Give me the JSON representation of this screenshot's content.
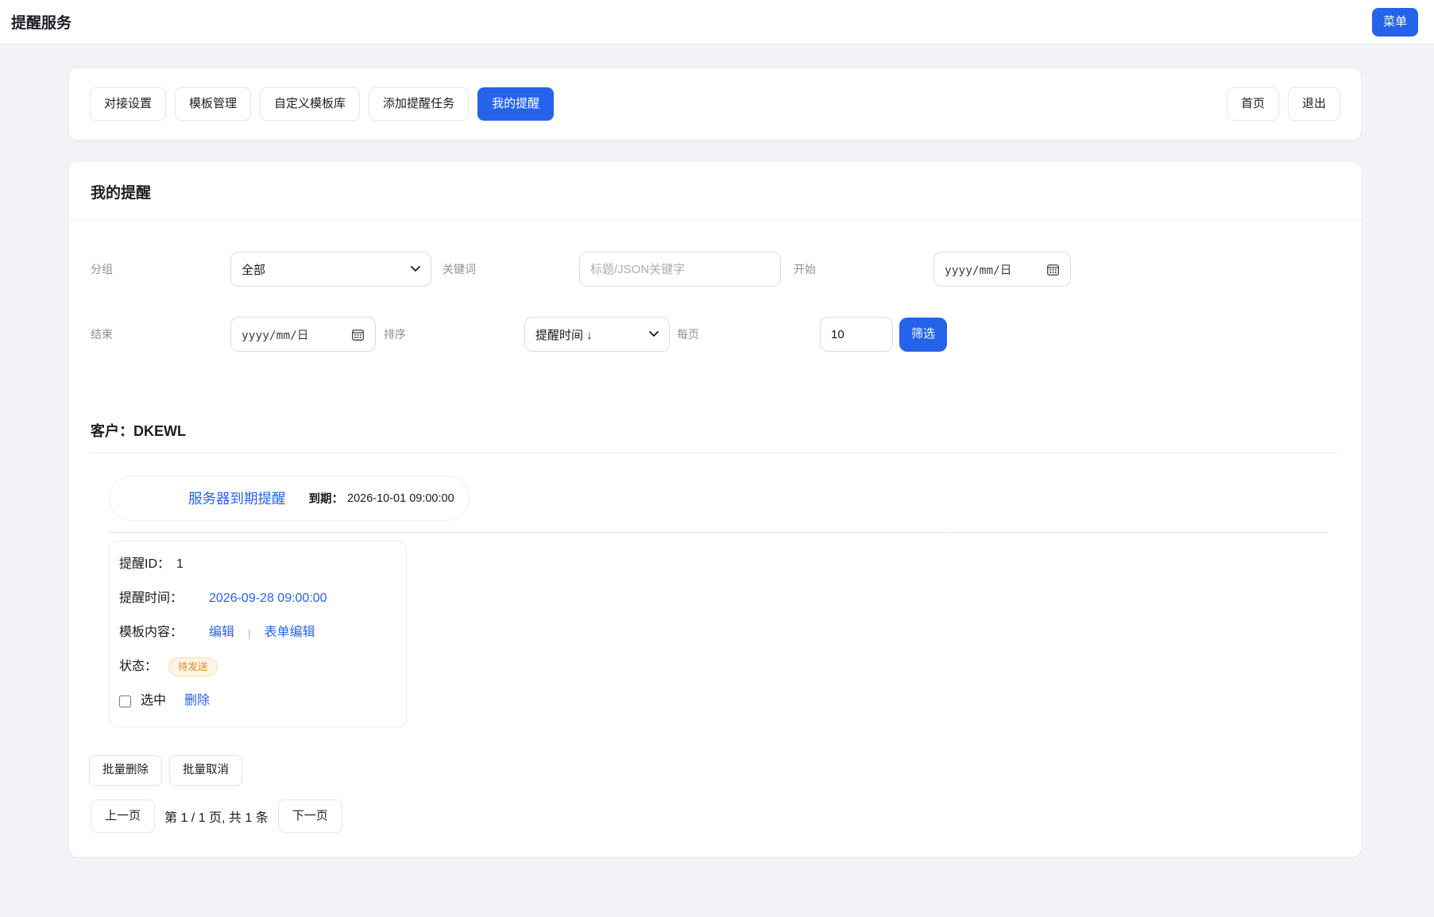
{
  "header": {
    "title": "提醒服务",
    "menu_button": "菜单"
  },
  "nav": {
    "tabs": [
      {
        "label": "对接设置",
        "active": false
      },
      {
        "label": "模板管理",
        "active": false
      },
      {
        "label": "自定义模板库",
        "active": false
      },
      {
        "label": "添加提醒任务",
        "active": false
      },
      {
        "label": "我的提醒",
        "active": true
      }
    ],
    "home_button": "首页",
    "logout_button": "退出"
  },
  "panel": {
    "title": "我的提醒",
    "filters": {
      "group_label": "分组",
      "group_value": "全部",
      "keyword_label": "关键词",
      "keyword_placeholder": "标题/JSON关键字",
      "start_label": "开始",
      "start_placeholder": "yyyy/mm/日",
      "end_label": "结束",
      "end_placeholder": "yyyy/mm/日",
      "sort_label": "排序",
      "sort_value": "提醒时间 ↓",
      "per_page_label": "每页",
      "per_page_value": "10",
      "filter_button": "筛选"
    },
    "customer": {
      "label": "客户：",
      "name": "DKEWL"
    },
    "reminder": {
      "title": "服务器到期提醒",
      "due_label": "到期：",
      "due_time": "2026-10-01 09:00:00",
      "detail": {
        "id_label": "提醒ID：",
        "id_value": "1",
        "time_label": "提醒时间：",
        "time_value": "2026-09-28 09:00:00",
        "template_label": "模板内容：",
        "edit_link": "编辑",
        "separator": "|",
        "form_edit_link": "表单编辑",
        "status_label": "状态：",
        "status_badge": "待发送",
        "select_label": "选中",
        "delete_link": "删除"
      }
    },
    "batch": {
      "delete_button": "批量删除",
      "cancel_button": "批量取消"
    },
    "pagination": {
      "prev_button": "上一页",
      "info": "第 1 / 1 页, 共 1 条",
      "next_button": "下一页"
    }
  },
  "colors": {
    "primary": "#2563eb",
    "link": "#2563eb",
    "badge_bg": "#fdf4e3",
    "badge_text": "#dd8a2c",
    "badge_border": "#f6dfb2",
    "page_bg": "#f1f3f6"
  }
}
